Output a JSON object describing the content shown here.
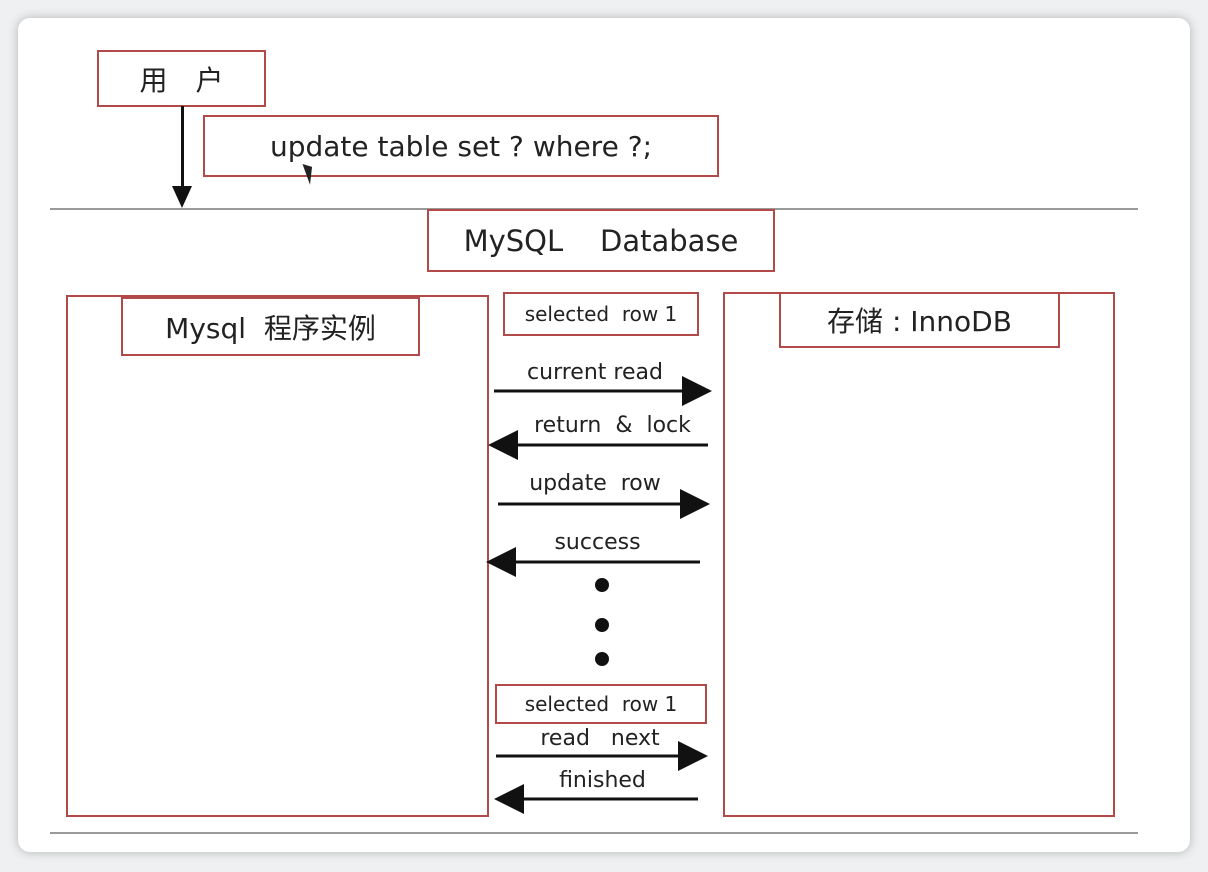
{
  "user_box": {
    "label": "用　户"
  },
  "sql_box": {
    "label": "update table set  ?  where  ?;"
  },
  "database_box": {
    "label": "MySQL    Database"
  },
  "mysql_instance": {
    "label": "Mysql  程序实例"
  },
  "storage": {
    "label": "存储 : InnoDB"
  },
  "top_selected": {
    "label": "selected  row 1"
  },
  "bottom_selected": {
    "label": "selected  row 1"
  },
  "messages": [
    {
      "label": "current read",
      "direction": "right"
    },
    {
      "label": "return  &  lock",
      "direction": "left"
    },
    {
      "label": "update  row",
      "direction": "right"
    },
    {
      "label": "success",
      "direction": "left"
    },
    {
      "label": "read   next",
      "direction": "right"
    },
    {
      "label": "finished",
      "direction": "left"
    }
  ],
  "colors": {
    "box_border": "#b34a4a",
    "divider": "#9a9a9a",
    "arrow": "#111111"
  }
}
